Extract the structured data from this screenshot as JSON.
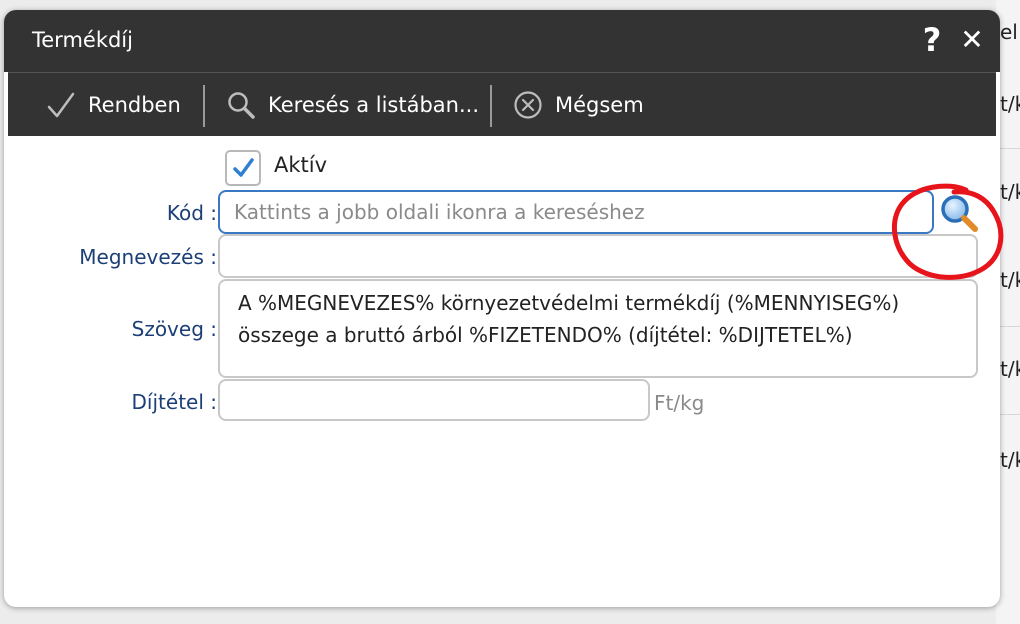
{
  "background": {
    "fragments": [
      "el",
      "t/k",
      "t/k",
      "t/k",
      "t/k",
      "t/k"
    ]
  },
  "dialog": {
    "title": "Termékdíj",
    "help_label": "?",
    "close_label": "✕"
  },
  "toolbar": {
    "ok_label": "Rendben",
    "search_label": "Keresés a listában...",
    "cancel_label": "Mégsem"
  },
  "form": {
    "active": {
      "label": "Aktív",
      "checked": true
    },
    "code": {
      "label": "Kód :",
      "value": "",
      "placeholder": "Kattints a jobb oldali ikonra a kereséshez"
    },
    "name": {
      "label": "Megnevezés :",
      "value": ""
    },
    "text": {
      "label": "Szöveg :",
      "value": "A %MEGNEVEZES% környezetvédelmi termékdíj (%MENNYISEG%) összege a bruttó árból %FIZETENDO% (díjtétel: %DIJTETEL%)"
    },
    "rate": {
      "label": "Díjtétel :",
      "value": "",
      "unit": "Ft/kg"
    }
  },
  "icons": {
    "ok": "checkmark-icon",
    "search": "magnifier-icon",
    "cancel": "circle-x-icon",
    "code_lookup": "magnifier-lookup-icon"
  },
  "colors": {
    "header_bg": "#333333",
    "label_color": "#1c3f78",
    "focus_border": "#3a78c3",
    "annotation": "#e8141c"
  }
}
